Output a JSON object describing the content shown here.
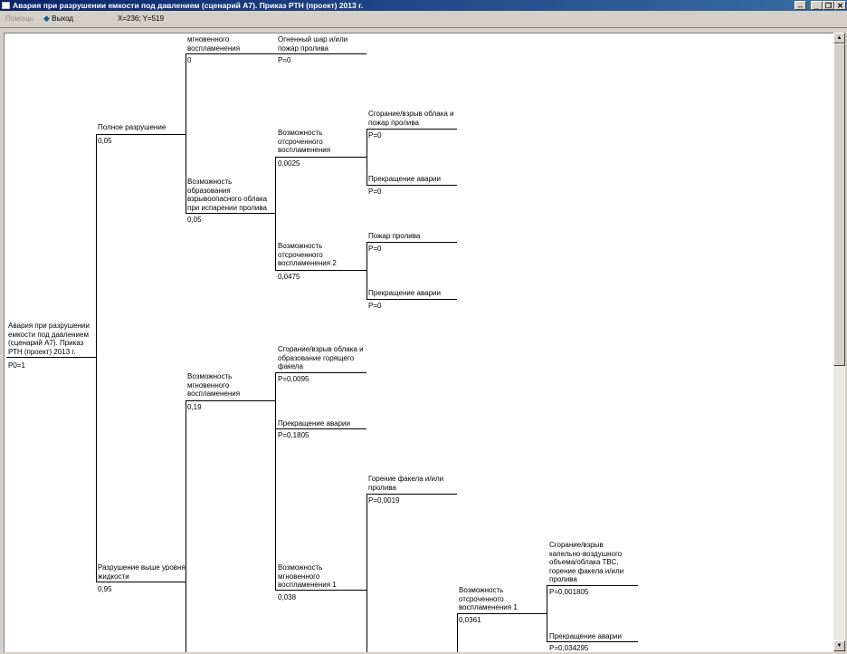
{
  "window": {
    "title": "Авария при разрушении емкости под давлением (сценарий А7). Приказ РТН (проект) 2013 г.",
    "buttons": {
      "resize": "↔",
      "minimize": "_",
      "restore": "❐",
      "close": "✕"
    }
  },
  "toolbar": {
    "help_label": "Помощь",
    "exit_label": "Выход",
    "coords": "X=236; Y=519"
  },
  "tree": {
    "root": {
      "label": "Авария при разрушении\nемкости под давлением\n(сценарий А7). Приказ\nРТН (проект) 2013 г.",
      "value": "P0=1"
    },
    "full_destruction": {
      "label": "Полное разрушение",
      "value": "0,05"
    },
    "instant_ignition_top": {
      "label": "мгновенного\nвоспламенения",
      "value": "0"
    },
    "fireball": {
      "label": "Огненный шар и/или\nпожар пролива",
      "value": "P=0"
    },
    "explosive_cloud": {
      "label": "Возможность\nобразования\nвзрывоопасного облака\nпри испарении пролива",
      "value": "0,05"
    },
    "delayed_ignition": {
      "label": "Возможность\nотсроченного\nвоспламенения",
      "value": "0,0025"
    },
    "cloud_combustion_1": {
      "label": "Сгорание/взрыв облака и\nпожар пролива",
      "value": "P=0"
    },
    "stop_1": {
      "label": "Прекращение аварии",
      "value": "P=0"
    },
    "delayed_ignition_2": {
      "label": "Возможность\nотсроченного\nвоспламенения 2",
      "value": "0,0475"
    },
    "pool_fire": {
      "label": "Пожар пролива",
      "value": "P=0"
    },
    "stop_2": {
      "label": "Прекращение аварии",
      "value": "P=0"
    },
    "instant_ignition_mid": {
      "label": "Возможность\nмгновенного\nвоспламенения",
      "value": "0,19"
    },
    "cloud_torch": {
      "label": "Сгорание/взрыв облака и\nобразование горящего\nфакела",
      "value": "P=0,0095"
    },
    "stop_3": {
      "label": "Прекращение аварии",
      "value": "P=0,1805"
    },
    "above_liquid": {
      "label": "Разрушение выше уровня\nжидкости",
      "value": "0,95"
    },
    "torch_pool": {
      "label": "Горение факела и/или\nпролива",
      "value": "P=0,0019"
    },
    "instant_ignition_1": {
      "label": "Возможность\nмгновенного\nвоспламенения 1",
      "value": "0,038"
    },
    "delayed_ignition_1": {
      "label": "Возможность\nотсроченного\nвоспламенения 1",
      "value": "0,0361"
    },
    "tvs_combustion": {
      "label": "Сгорание/взрыв\nкапельно-воздушного\nобъема/облака ТВС,\nгорение факела и/или\nпролива",
      "value": "P=0,001805"
    },
    "stop_4": {
      "label": "Прекращение аварии",
      "value": "P=0,034295"
    }
  }
}
